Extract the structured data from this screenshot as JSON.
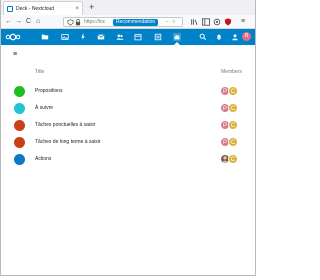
{
  "browser": {
    "tab_title": "Deck - Nextcloud",
    "tab_close": "×",
    "new_tab": "+",
    "url_text": "https://loc",
    "url_pill": "Recommendation",
    "url_meta": "··· ☆",
    "back": "←",
    "forward": "→",
    "reload": "C",
    "home": "⌂"
  },
  "colors": {
    "nextcloud_blue": "#0082c9",
    "board_green": "#1fbf1f",
    "board_cyan": "#22c5d1",
    "board_orange_1": "#c8401a",
    "board_orange_2": "#c8401a",
    "board_blue": "#0c79c7"
  },
  "toolbar": {
    "menu_icon": "≡"
  },
  "table": {
    "title_header": "Title",
    "members_header": "Members",
    "rows": [
      {
        "title": "Propositions",
        "color": "#1fbf1f",
        "avatars": [
          "P",
          "C"
        ]
      },
      {
        "title": "À suivre",
        "color": "#22c5d1",
        "avatars": [
          "P",
          "C"
        ]
      },
      {
        "title": "Tâches ponctuelles à saisir",
        "color": "#c8401a",
        "avatars": [
          "P",
          "C"
        ]
      },
      {
        "title": "Tâches de long terme à saisir",
        "color": "#c8401a",
        "avatars": [
          "P",
          "C"
        ]
      },
      {
        "title": "Actions",
        "color": "#0c79c7",
        "avatars": [
          "photo",
          "C"
        ]
      }
    ]
  },
  "header": {
    "user_initial": "B"
  }
}
